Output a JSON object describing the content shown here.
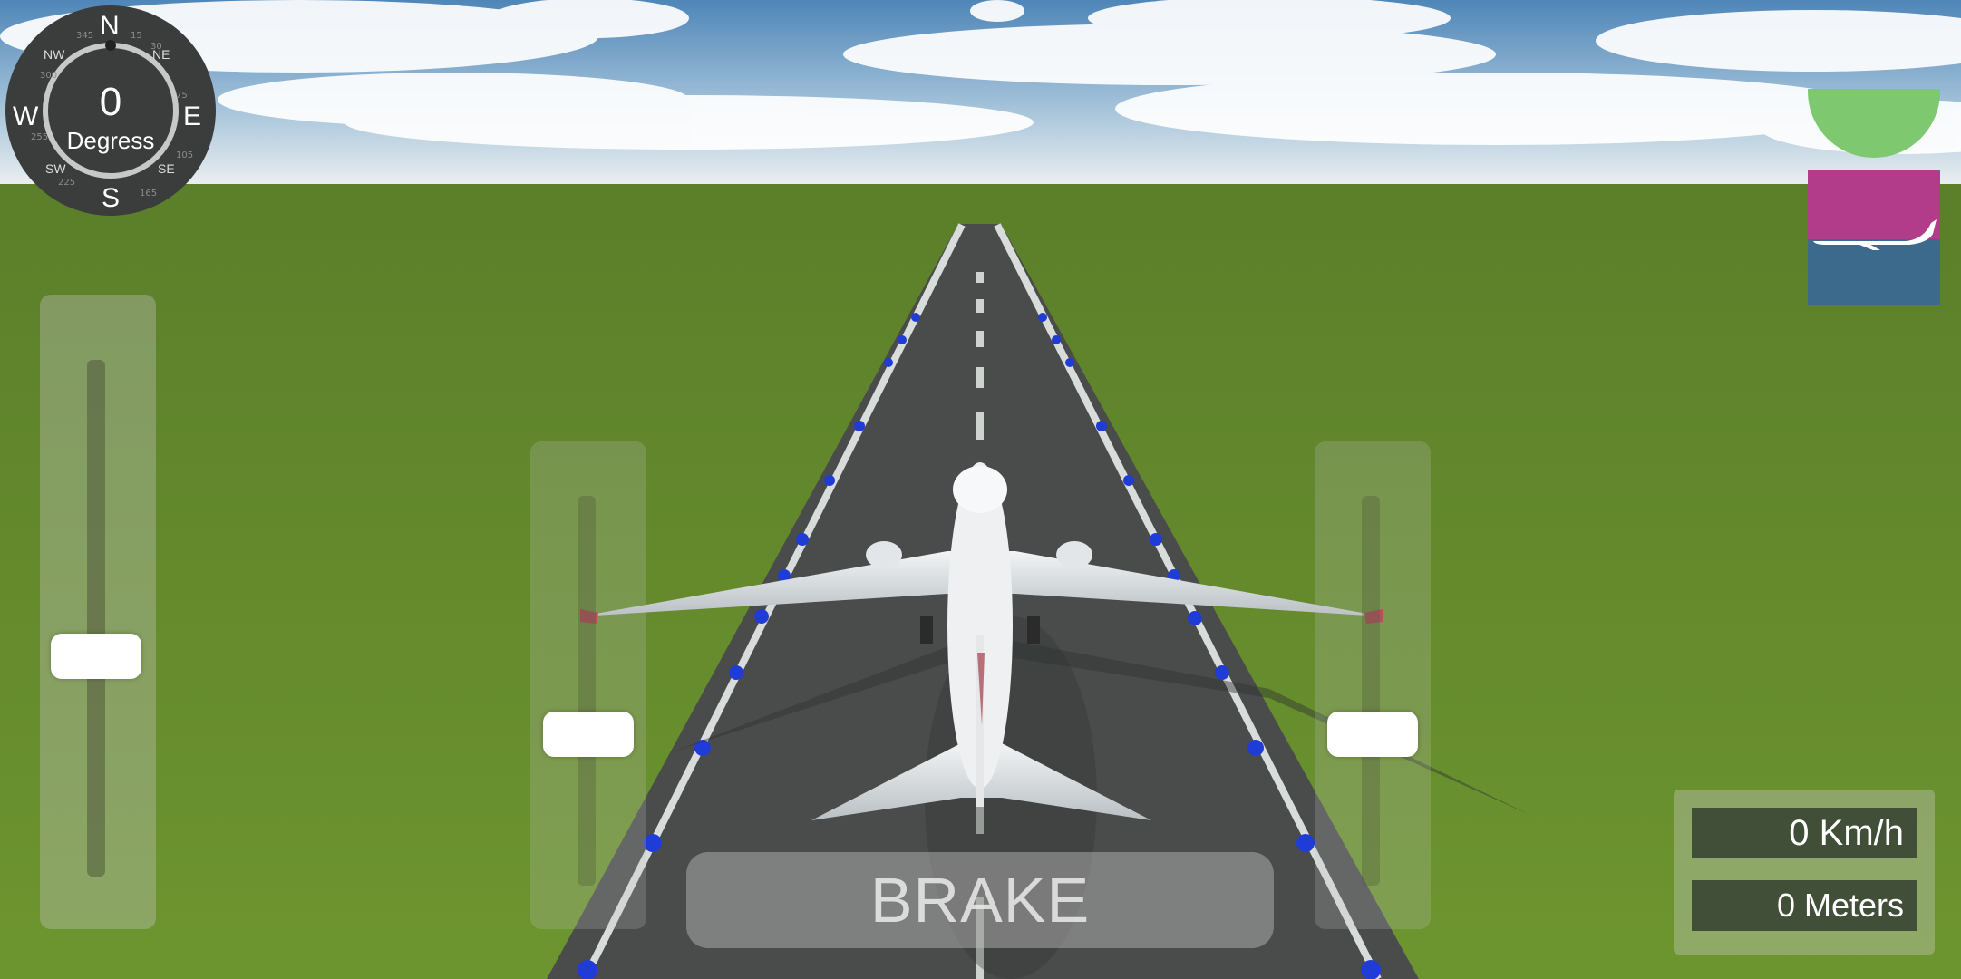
{
  "compass": {
    "heading_value": "0",
    "heading_unit": "Degress",
    "cardinals": {
      "n": "N",
      "e": "E",
      "s": "S",
      "w": "W"
    },
    "intercardinals": {
      "ne": "NE",
      "nw": "NW",
      "se": "SE",
      "sw": "SW"
    }
  },
  "controls": {
    "brake_label": "BRAKE",
    "throttle_level": 0.42,
    "left_pitch_level": 0.38,
    "right_pitch_level": 0.38
  },
  "hud": {
    "speed": "0 Km/h",
    "altitude": "0 Meters"
  },
  "attitude_indicator": {
    "ball_color": "#7ec970",
    "sky_color": "#b23c8a",
    "ground_color": "#3c6a8c",
    "icon": "airplane-icon"
  },
  "colors": {
    "runway_light": "#1f3cd6",
    "grass": "#5e8a2a"
  }
}
